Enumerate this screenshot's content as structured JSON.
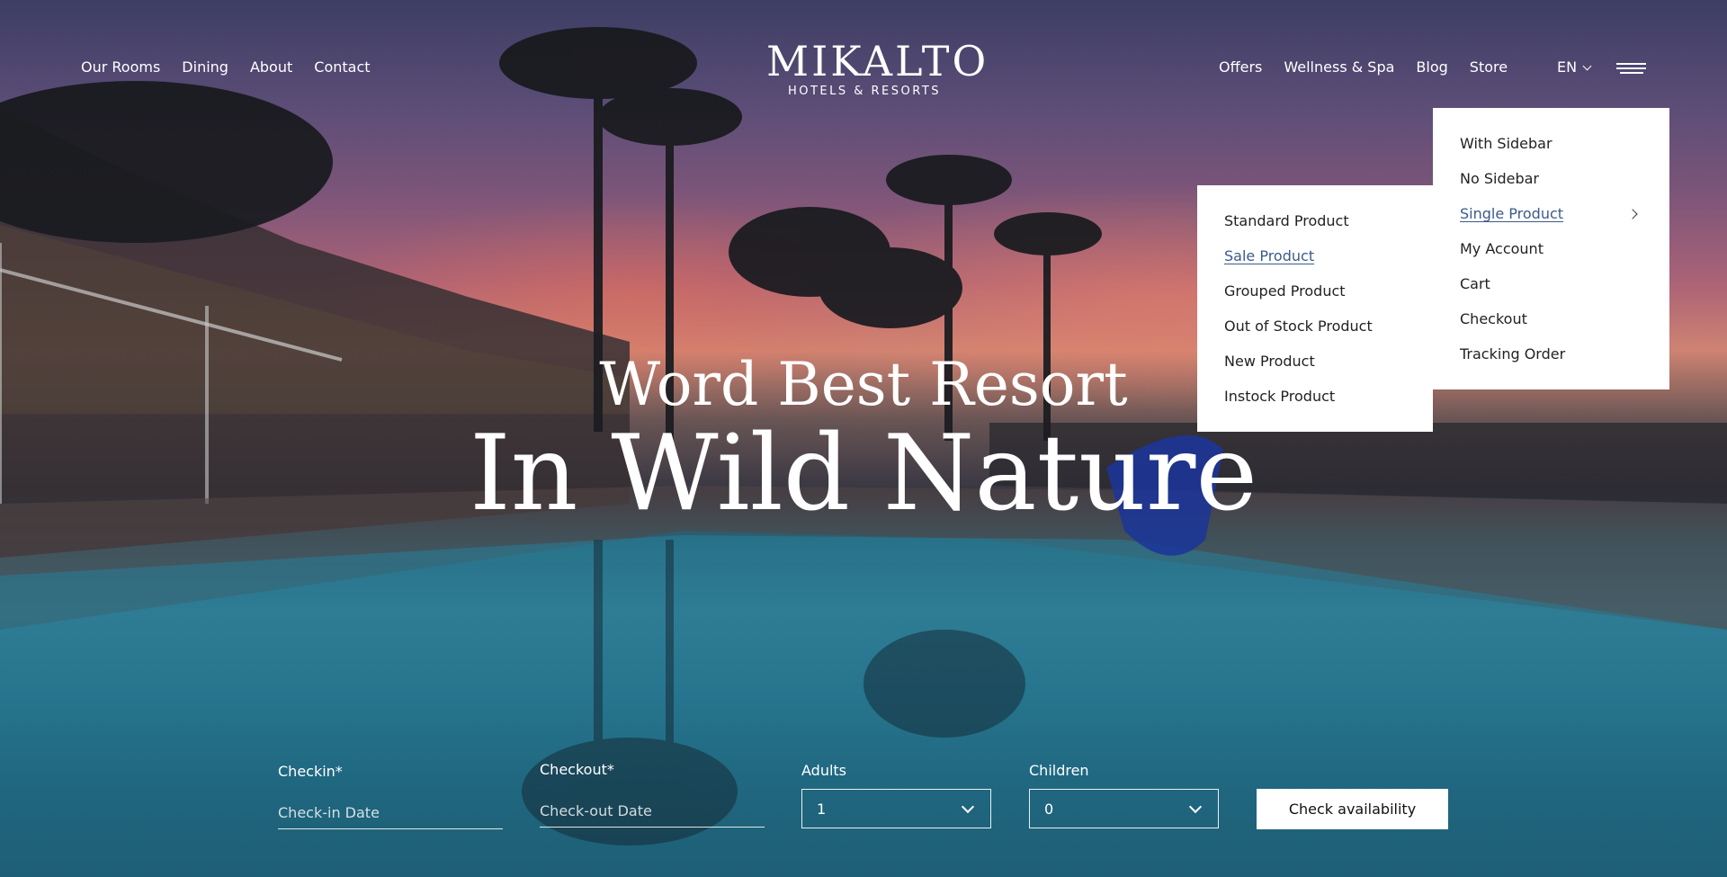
{
  "header": {
    "left_nav": [
      {
        "label": "Our Rooms"
      },
      {
        "label": "Dining"
      },
      {
        "label": "About"
      },
      {
        "label": "Contact"
      }
    ],
    "right_nav": [
      {
        "label": "Offers"
      },
      {
        "label": "Wellness & Spa"
      },
      {
        "label": "Blog"
      },
      {
        "label": "Store"
      }
    ],
    "language": "EN",
    "logo": {
      "title": "MIKALTO",
      "subtitle": "HOTELS & RESORTS"
    },
    "menu_icon": "hamburger-icon"
  },
  "store_menu": {
    "items": [
      {
        "label": "With Sidebar"
      },
      {
        "label": "No Sidebar"
      },
      {
        "label": "Single Product",
        "active": true,
        "has_submenu": true
      },
      {
        "label": "My Account"
      },
      {
        "label": "Cart"
      },
      {
        "label": "Checkout"
      },
      {
        "label": "Tracking Order"
      }
    ]
  },
  "single_product_submenu": {
    "items": [
      {
        "label": "Standard Product"
      },
      {
        "label": "Sale Product",
        "active": true
      },
      {
        "label": "Grouped Product"
      },
      {
        "label": "Out of Stock Product"
      },
      {
        "label": "New Product"
      },
      {
        "label": "Instock Product"
      }
    ]
  },
  "hero": {
    "headline_top": "Word Best Resort",
    "headline_main": "In Wild Nature"
  },
  "booking": {
    "checkin": {
      "label": "Checkin*",
      "placeholder": "Check-in Date",
      "value": ""
    },
    "checkout": {
      "label": "Checkout*",
      "placeholder": "Check-out Date",
      "value": ""
    },
    "adults": {
      "label": "Adults",
      "value": "1"
    },
    "children": {
      "label": "Children",
      "value": "0"
    },
    "submit_label": "Check availability"
  },
  "colors": {
    "active_link": "#3c5a8a",
    "text_light": "#ffffff",
    "menu_bg": "#ffffff"
  }
}
